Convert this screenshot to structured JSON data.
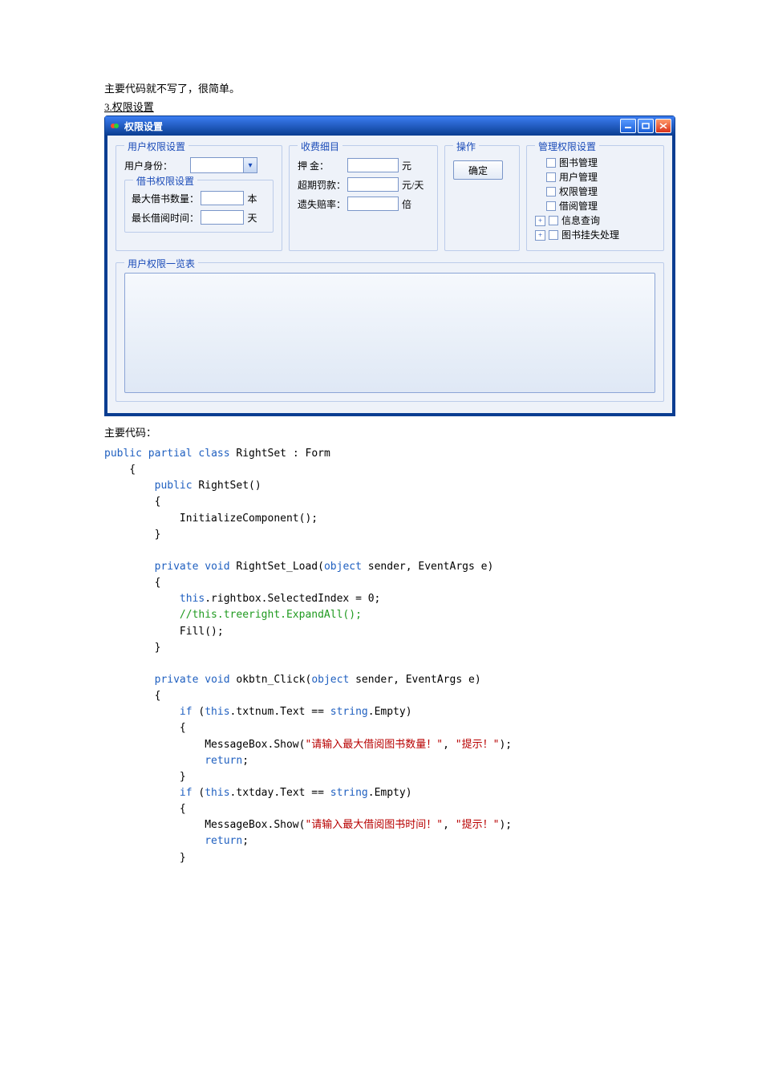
{
  "intro": {
    "line1": "主要代码就不写了，很简单。",
    "section": "3.权限设置",
    "codeIntro": "主要代码："
  },
  "window": {
    "title": "权限设置",
    "groups": {
      "userRight": "用户权限设置",
      "borrowRight": "借书权限设置",
      "feeDetail": "收费细目",
      "operation": "操作",
      "adminRight": "管理权限设置",
      "rightsList": "用户权限一览表"
    },
    "labels": {
      "userRole": "用户身份：",
      "maxBorrow": "最大借书数量：",
      "maxDays": "最长借阅时间：",
      "deposit": "押    金：",
      "overdueFine": "超期罚款：",
      "lossRate": "遗失赔率："
    },
    "units": {
      "book": "本",
      "day": "天",
      "yuan": "元",
      "yuanPerDay": "元/天",
      "times": "倍"
    },
    "buttons": {
      "ok": "确定"
    },
    "tree": [
      "图书管理",
      "用户管理",
      "权限管理",
      "借阅管理",
      "信息查询",
      "图书挂失处理"
    ]
  },
  "code": {
    "className": "RightSet",
    "base": "Form",
    "loadMethod": "RightSet_Load",
    "okMethod": "okbtn_Click",
    "msg1": "请输入最大借阅图书数量！",
    "msg2": "请输入最大借阅图书时间！",
    "msgTitle": "提示！"
  }
}
